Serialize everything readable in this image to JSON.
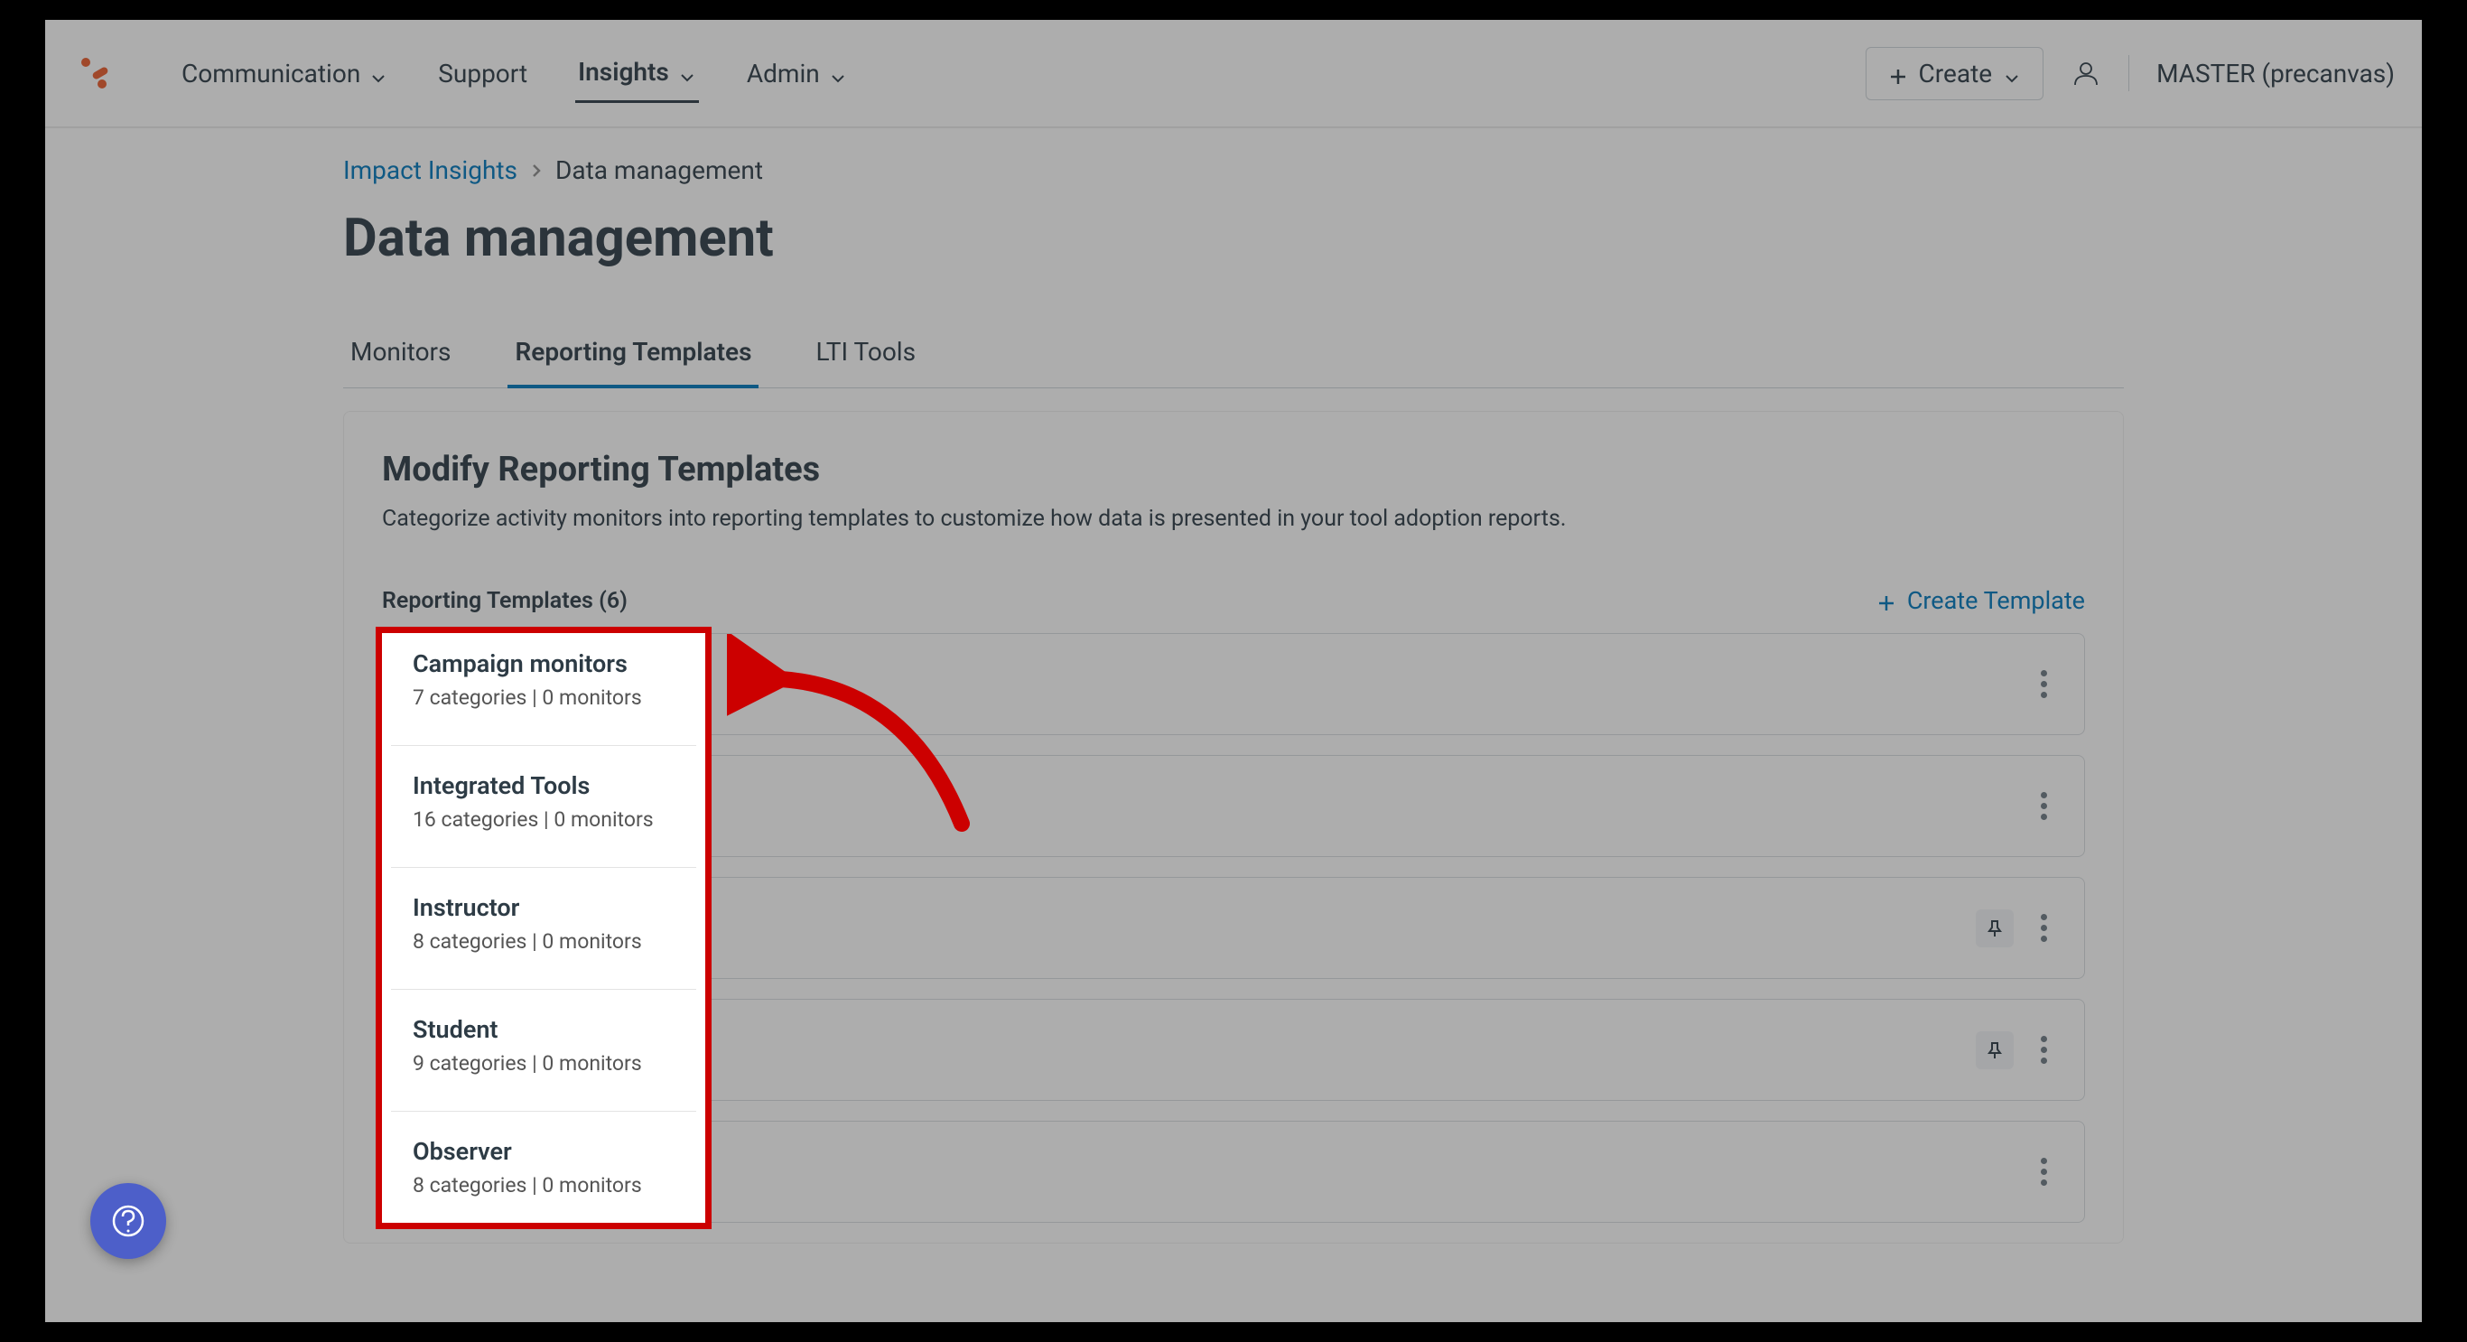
{
  "nav": {
    "items": [
      {
        "label": "Communication",
        "hasChevron": true
      },
      {
        "label": "Support",
        "hasChevron": false
      },
      {
        "label": "Insights",
        "hasChevron": true,
        "active": true
      },
      {
        "label": "Admin",
        "hasChevron": true
      }
    ],
    "create_label": "Create",
    "user_label": "MASTER (precanvas)"
  },
  "breadcrumb": {
    "link": "Impact Insights",
    "current": "Data management"
  },
  "page_title": "Data management",
  "tabs": [
    {
      "label": "Monitors"
    },
    {
      "label": "Reporting Templates",
      "active": true
    },
    {
      "label": "LTI Tools"
    }
  ],
  "panel": {
    "title": "Modify Reporting Templates",
    "description": "Categorize activity monitors into reporting templates to customize how data is presented in your tool adoption reports.",
    "count_label": "Reporting Templates (6)",
    "create_template_label": "Create Template"
  },
  "templates": [
    {
      "name": "Campaign monitors",
      "categories": "7 categories",
      "monitors": "0 monitors",
      "pinned": false
    },
    {
      "name": "Integrated Tools",
      "categories": "16 categories",
      "monitors": "0 monitors",
      "pinned": false
    },
    {
      "name": "Instructor",
      "categories": "8 categories",
      "monitors": "0 monitors",
      "pinned": true
    },
    {
      "name": "Student",
      "categories": "9 categories",
      "monitors": "0 monitors",
      "pinned": true
    },
    {
      "name": "Observer",
      "categories": "8 categories",
      "monitors": "0 monitors",
      "pinned": false
    }
  ]
}
